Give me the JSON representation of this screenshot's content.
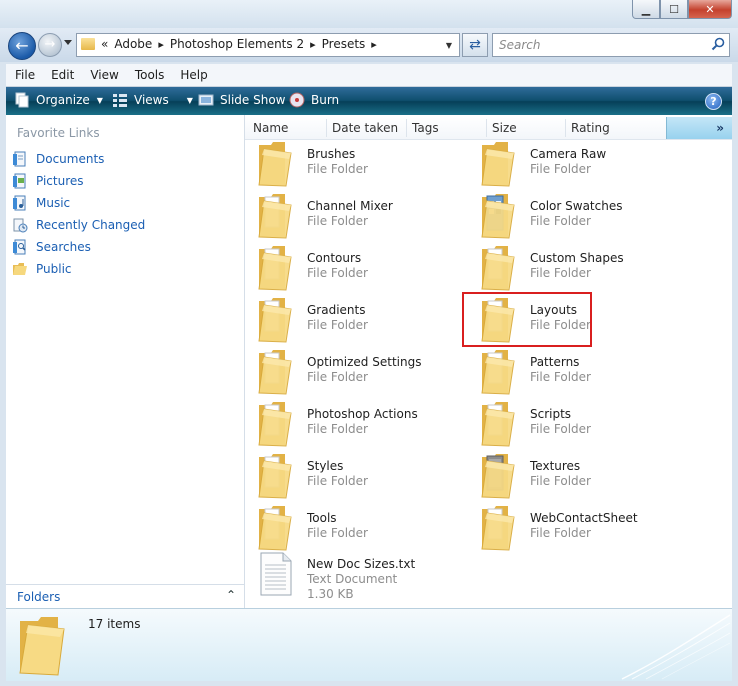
{
  "window": {
    "controls": {
      "minimize": "▁",
      "maximize": "☐",
      "close": "✕"
    }
  },
  "nav": {
    "breadcrumb_prefix": "«",
    "breadcrumbs": [
      "Adobe",
      "Photoshop Elements 2",
      "Presets"
    ],
    "separator": "▸",
    "search_placeholder": "Search"
  },
  "menu": [
    "File",
    "Edit",
    "View",
    "Tools",
    "Help"
  ],
  "toolbar": {
    "organize": "Organize",
    "views": "Views",
    "slideshow": "Slide Show",
    "burn": "Burn",
    "help": "?"
  },
  "sidebar": {
    "heading": "Favorite Links",
    "items": [
      {
        "label": "Documents",
        "icon": "documents-icon"
      },
      {
        "label": "Pictures",
        "icon": "pictures-icon"
      },
      {
        "label": "Music",
        "icon": "music-icon"
      },
      {
        "label": "Recently Changed",
        "icon": "recently-changed-icon"
      },
      {
        "label": "Searches",
        "icon": "searches-icon"
      },
      {
        "label": "Public",
        "icon": "folder-icon"
      }
    ],
    "folders_label": "Folders",
    "folders_toggle": "⌃"
  },
  "columns": [
    "Name",
    "Date taken",
    "Tags",
    "Size",
    "Rating"
  ],
  "columns_more": "»",
  "items": [
    {
      "name": "Brushes",
      "type": "File Folder",
      "kind": "folder"
    },
    {
      "name": "Camera Raw",
      "type": "File Folder",
      "kind": "folder"
    },
    {
      "name": "Channel Mixer",
      "type": "File Folder",
      "kind": "folder-pages"
    },
    {
      "name": "Color Swatches",
      "type": "File Folder",
      "kind": "folder-blue"
    },
    {
      "name": "Contours",
      "type": "File Folder",
      "kind": "folder-pages"
    },
    {
      "name": "Custom Shapes",
      "type": "File Folder",
      "kind": "folder-pages"
    },
    {
      "name": "Gradients",
      "type": "File Folder",
      "kind": "folder-pages"
    },
    {
      "name": "Layouts",
      "type": "File Folder",
      "kind": "folder-pages"
    },
    {
      "name": "Optimized Settings",
      "type": "File Folder",
      "kind": "folder-pages"
    },
    {
      "name": "Patterns",
      "type": "File Folder",
      "kind": "folder-pages"
    },
    {
      "name": "Photoshop Actions",
      "type": "File Folder",
      "kind": "folder-pages"
    },
    {
      "name": "Scripts",
      "type": "File Folder",
      "kind": "folder-pages"
    },
    {
      "name": "Styles",
      "type": "File Folder",
      "kind": "folder-pages"
    },
    {
      "name": "Textures",
      "type": "File Folder",
      "kind": "folder-texture"
    },
    {
      "name": "Tools",
      "type": "File Folder",
      "kind": "folder-pages"
    },
    {
      "name": "WebContactSheet",
      "type": "File Folder",
      "kind": "folder-pages"
    },
    {
      "name": "New Doc Sizes.txt",
      "type": "Text Document",
      "size": "1.30 KB",
      "kind": "text"
    }
  ],
  "highlighted_item": "Layouts",
  "details": {
    "count": "17 items"
  },
  "colors": {
    "link": "#1b5fb3",
    "toolbar": "#0f4f6e",
    "highlight": "#d91f1f",
    "folder": "#f0cd6d"
  }
}
